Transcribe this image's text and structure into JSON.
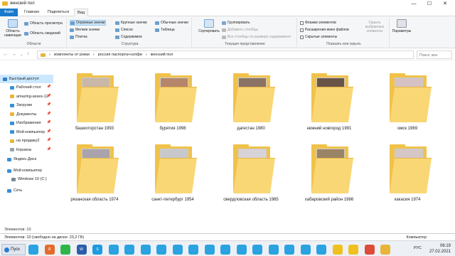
{
  "window": {
    "title": "женский пол",
    "controls": [
      "—",
      "☐",
      "✕"
    ]
  },
  "tabs": [
    "Файл",
    "Главная",
    "Поделиться",
    "Вид"
  ],
  "ribbon": {
    "panes_group_label": "Области",
    "nav_pane_label": "Область навигации",
    "preview_pane_label": "Область просмотра",
    "details_pane_label": "Область сведений",
    "layout_group_label": "Структура",
    "layout_items": [
      "Огромные значки",
      "Крупные значки",
      "Обычные значки",
      "Мелкие значки",
      "Список",
      "Таблица",
      "Плитка",
      "Содержимое"
    ],
    "current_view_group_label": "Текущее представление",
    "sort_label": "Сортировать",
    "group_by_label": "Группировать",
    "add_columns_label": "Добавить столбцы",
    "size_all_columns_label": "Все столбцы по размеру содержимого",
    "show_hide_group_label": "Показать или скрыть",
    "item_checkboxes_label": "Флажки элементов",
    "file_extensions_label": "Расширения имен файлов",
    "hidden_items_label": "Скрытые элементы",
    "hide_selected_label": "Скрыть выбранные элементы",
    "options_label": "Параметры"
  },
  "address": {
    "breadcrumb": [
      "комплекты от рокки",
      "россия паспорта+селфи",
      "женский пол"
    ],
    "search_placeholder": "Поиск: жен"
  },
  "nav": {
    "quick_access": "Быстрый доступ",
    "items": [
      {
        "label": "Рабочий стол",
        "pinned": true,
        "color": "#3b8fd9"
      },
      {
        "label": "amazing-asses-12",
        "pinned": true,
        "color": "#e8b53a"
      },
      {
        "label": "Загрузки",
        "pinned": true,
        "color": "#3b8fd9"
      },
      {
        "label": "Документы",
        "pinned": true,
        "color": "#e8b53a"
      },
      {
        "label": "Изображения",
        "pinned": true,
        "color": "#3b8fd9"
      },
      {
        "label": "Мой компьютер",
        "pinned": true,
        "color": "#3b8fd9"
      },
      {
        "label": "на продажу2",
        "pinned": true,
        "color": "#e8b53a"
      },
      {
        "label": "Корзина",
        "pinned": true,
        "color": "#9aa4ad"
      }
    ],
    "yandex_disk": "Яндекс.Диск",
    "this_pc": "Мой компьютер",
    "drive": "Windows 10 (C:)",
    "network": "Сеть"
  },
  "folders": [
    {
      "label": "башкоторстан 1993",
      "paper": "#c9b7a8"
    },
    {
      "label": "бурятия 1998",
      "paper": "#b5866b"
    },
    {
      "label": "дагестан 1980",
      "paper": "#8a7264"
    },
    {
      "label": "нижний новгород 1991",
      "paper": "#6a5448"
    },
    {
      "label": "омск 1969",
      "paper": "#d6c2c4"
    },
    {
      "label": "рязанская область 1974",
      "paper": "#a9a4ab"
    },
    {
      "label": "санкт-петербург 1954",
      "paper": "#c6c8cc"
    },
    {
      "label": "свердловская область 1985",
      "paper": "#d8d3d8"
    },
    {
      "label": "хабаровский район 1986",
      "paper": "#9a8466"
    },
    {
      "label": "хакасия 1974",
      "paper": "#d5c6c8"
    }
  ],
  "status": {
    "count_text": "Элементов: 10",
    "info_text": "Элементов: 10 (свободно на диске: 23,2 ГБ)",
    "location": "Компьютер"
  },
  "taskbar": {
    "start_label": "Пуск",
    "icons": [
      {
        "name": "telegram-icon",
        "color": "#2aa3e0",
        "label": ""
      },
      {
        "name": "browser-icon",
        "color": "#e46b2b",
        "label": "Я"
      },
      {
        "name": "whatsapp-icon",
        "color": "#2fb64a",
        "label": ""
      },
      {
        "name": "word-icon",
        "color": "#2b5eab",
        "label": "W"
      },
      {
        "name": "skype-icon",
        "color": "#1f9be0",
        "label": "S"
      },
      {
        "name": "telegram-icon",
        "color": "#2aa3e0",
        "label": ""
      },
      {
        "name": "telegram-icon",
        "color": "#2aa3e0",
        "label": ""
      },
      {
        "name": "telegram-icon",
        "color": "#2aa3e0",
        "label": ""
      },
      {
        "name": "telegram-icon",
        "color": "#2aa3e0",
        "label": ""
      },
      {
        "name": "telegram-icon",
        "color": "#2aa3e0",
        "label": ""
      },
      {
        "name": "telegram-icon",
        "color": "#2aa3e0",
        "label": ""
      },
      {
        "name": "telegram-icon",
        "color": "#2aa3e0",
        "label": ""
      },
      {
        "name": "telegram-icon",
        "color": "#2aa3e0",
        "label": ""
      },
      {
        "name": "telegram-icon",
        "color": "#2aa3e0",
        "label": ""
      },
      {
        "name": "telegram-icon",
        "color": "#2aa3e0",
        "label": ""
      },
      {
        "name": "telegram-icon",
        "color": "#2aa3e0",
        "label": ""
      },
      {
        "name": "telegram-icon",
        "color": "#2aa3e0",
        "label": ""
      },
      {
        "name": "telegram-icon",
        "color": "#2aa3e0",
        "label": ""
      },
      {
        "name": "telegram-icon",
        "color": "#2aa3e0",
        "label": ""
      },
      {
        "name": "emoji-icon",
        "color": "#f0c020",
        "label": ""
      },
      {
        "name": "emoji-icon",
        "color": "#f0c020",
        "label": ""
      },
      {
        "name": "chrome-icon",
        "color": "#dd4b39",
        "label": ""
      },
      {
        "name": "folder-icon",
        "color": "#e8b53a",
        "label": ""
      }
    ],
    "lang": "РУС",
    "time": "06:19",
    "date": "27.02.2021"
  }
}
